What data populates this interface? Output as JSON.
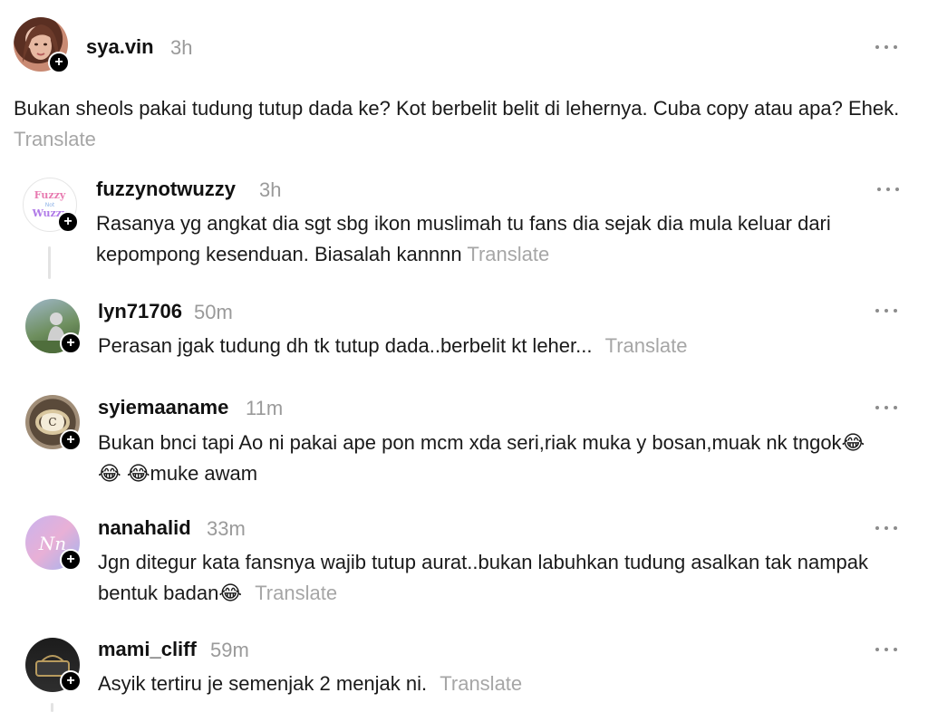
{
  "main_post": {
    "username": "sya.vin",
    "time": "3h",
    "text": "Bukan sheols pakai tudung tutup dada ke? Kot berbelit belit di lehernya. Cuba copy atau apa? Ehek.",
    "translate": "Translate",
    "avatar_icon": "profile-photo-woman"
  },
  "replies": [
    {
      "username": "fuzzynotwuzzy",
      "time": "3h",
      "text": "Rasanya yg angkat dia sgt sbg ikon muslimah tu fans dia sejak dia mula keluar dari kepompong kesenduan. Biasalah kannnn",
      "translate": "Translate",
      "avatar_text": "Fuzzy Not Wuzzy"
    },
    {
      "username": "lyn71706",
      "time": "50m",
      "text": "Perasan jgak tudung dh tk tutup dada..berbelit kt leher...",
      "translate": "Translate"
    },
    {
      "username": "syiemaaname",
      "time": "11m",
      "text": "Bukan bnci tapi Ao ni pakai ape pon mcm xda seri,riak muka y bosan,muak nk tngok😂 😂 😂muke awam",
      "translate": ""
    },
    {
      "username": "nanahalid",
      "time": "33m",
      "text": "Jgn ditegur kata fansnya wajib tutup aurat..bukan labuhkan tudung asalkan tak nampak bentuk badan😂",
      "translate": "Translate"
    },
    {
      "username": "mami_cliff",
      "time": "59m",
      "text": "Asyik tertiru je semenjak 2 menjak ni.",
      "translate": "Translate"
    }
  ],
  "follow_symbol": "+",
  "colors": {
    "text": "#1a1a1a",
    "muted": "#9a9a9a",
    "translate": "#a6a6a6",
    "badge": "#000000"
  }
}
